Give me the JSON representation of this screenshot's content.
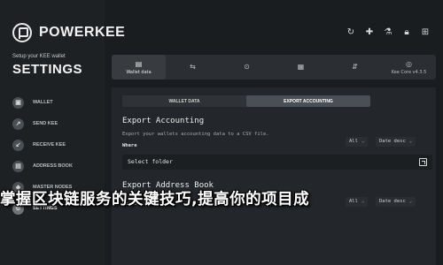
{
  "brand": {
    "name": "POWERKEE"
  },
  "sidebar": {
    "subtitle": "Setup your KEE wallet",
    "title": "SETTINGS",
    "items": [
      {
        "label": "WALLET",
        "icon": "wallet-icon"
      },
      {
        "label": "SEND KEE",
        "icon": "send-icon"
      },
      {
        "label": "RECEIVE KEE",
        "icon": "receive-icon"
      },
      {
        "label": "ADDRESS BOOK",
        "icon": "address-book-icon"
      },
      {
        "label": "MASTER NODES",
        "icon": "master-nodes-icon"
      },
      {
        "label": "SETTINGS",
        "icon": "gear-icon",
        "active": true
      }
    ]
  },
  "top_icons": [
    "sync-icon",
    "add-icon",
    "flask-icon",
    "lock-icon",
    "network-icon"
  ],
  "tabs": [
    {
      "label": "Wallet data",
      "icon": "wallet-data-icon",
      "active": true
    },
    {
      "label": "",
      "icon": "tab-2-icon"
    },
    {
      "label": "",
      "icon": "tab-3-icon"
    },
    {
      "label": "",
      "icon": "tab-4-icon"
    },
    {
      "label": "",
      "icon": "tab-5-icon"
    },
    {
      "label": "Kee Core v4.3.5",
      "icon": "kee-core-icon"
    }
  ],
  "subtabs": [
    {
      "label": "WALLET DATA",
      "active": false
    },
    {
      "label": "EXPORT ACCOUNTING",
      "active": true
    }
  ],
  "export_accounting": {
    "title": "Export Accounting",
    "description": "Export your wallets accounting data to a CSV file.",
    "where_label": "Where",
    "filter_value": "All",
    "sort_value": "Date desc",
    "folder_value": "Select folder"
  },
  "export_address_book": {
    "title": "Export Address Book",
    "where_label": "Where",
    "filter_value": "All",
    "sort_value": "Date desc"
  },
  "overlay": {
    "text": "掌握区块链服务的关键技巧,提高你的项目成"
  }
}
